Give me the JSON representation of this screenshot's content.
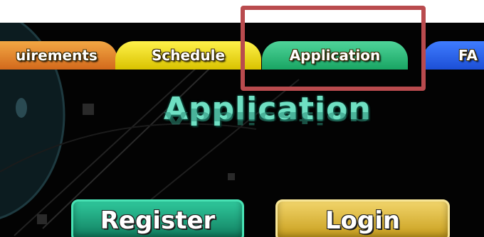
{
  "tabs": [
    {
      "label": "uirements",
      "color": "#e08a2e"
    },
    {
      "label": "Schedule",
      "color": "#f2de1f"
    },
    {
      "label": "Application",
      "color": "#26b878"
    },
    {
      "label": "FA",
      "color": "#2f67f0"
    }
  ],
  "page": {
    "title": "Application",
    "title_color": "#6fe0c3"
  },
  "buttons": {
    "register": {
      "label": "Register",
      "color": "#1fa57c"
    },
    "login": {
      "label": "Login",
      "color": "#e0bd3c"
    }
  },
  "highlight": {
    "color": "#b94b4e"
  }
}
